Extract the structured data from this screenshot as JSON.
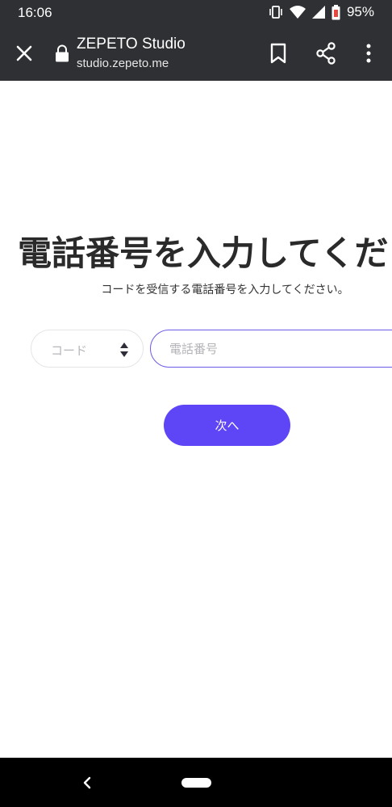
{
  "status_bar": {
    "time": "16:06",
    "battery": "95%"
  },
  "browser": {
    "title": "ZEPETO Studio",
    "url": "studio.zepeto.me"
  },
  "page": {
    "title": "電話番号を入力してください",
    "subtitle": "コードを受信する電話番号を入力してください。",
    "code_select": {
      "label": "コード"
    },
    "phone_input": {
      "placeholder": "電話番号",
      "value": ""
    },
    "next_button": {
      "label": "次へ"
    }
  },
  "colors": {
    "accent": "#5e45f5",
    "input_border": "#6b5ce7",
    "chrome": "#2f3033"
  }
}
